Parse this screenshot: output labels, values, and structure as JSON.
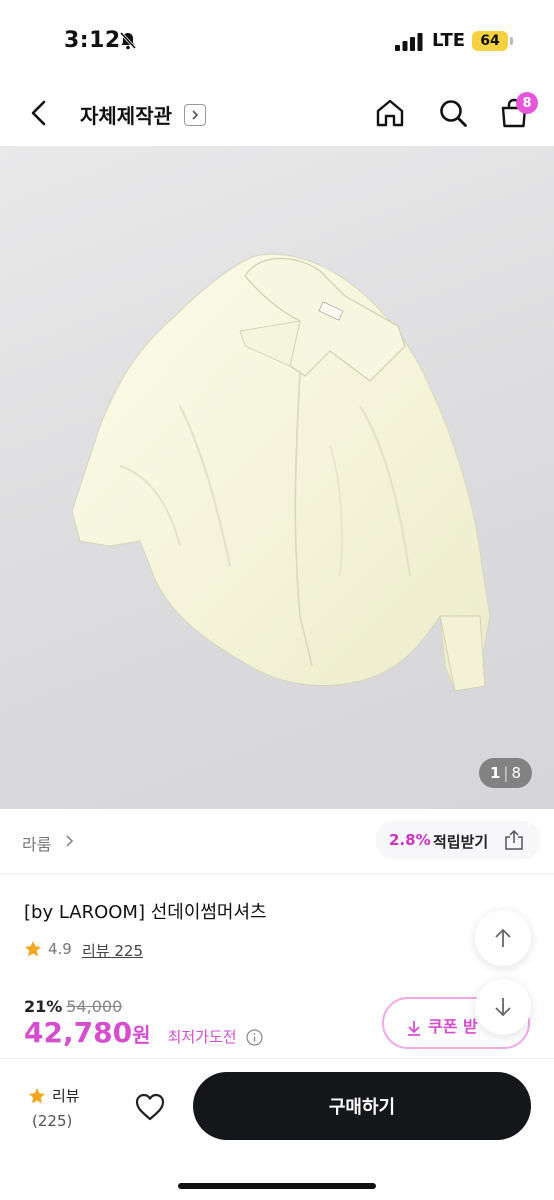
{
  "status_bar": {
    "time": "3:12",
    "network": "LTE",
    "battery": "64"
  },
  "header": {
    "store_title": "자체제작관",
    "cart_count": "8"
  },
  "gallery": {
    "current": "1",
    "total": "8"
  },
  "brand": {
    "name": "라룸",
    "reward_rate": "2.8%",
    "reward_label": "적립받기"
  },
  "product": {
    "name": "[by LAROOM] 선데이썸머셔츠",
    "rating": "4.9",
    "review_link": "리뷰 225",
    "discount_rate": "21%",
    "original_price": "54,000",
    "sale_price": "42,780",
    "currency": "원",
    "lowest_price_label": "최저가도전",
    "coupon_label": "쿠폰 받"
  },
  "bottom_bar": {
    "review_label": "리뷰",
    "review_count": "(225)",
    "buy_label": "구매하기"
  },
  "colors": {
    "accent": "#d64ed0",
    "badge": "#e756d9",
    "buy_button": "#15161a"
  }
}
